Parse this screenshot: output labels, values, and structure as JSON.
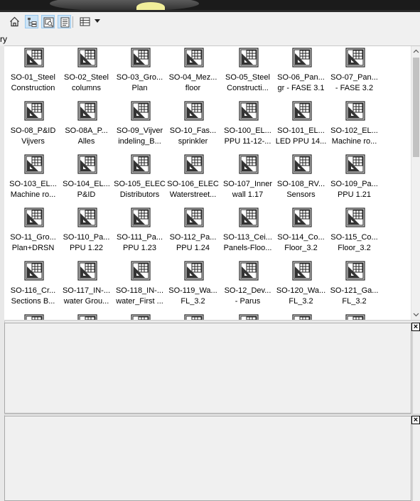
{
  "toolbar": {
    "buttons": [
      {
        "name": "home-button",
        "icon": "home-icon",
        "active": false
      },
      {
        "name": "tree-view-button",
        "icon": "tree-view-icon",
        "active": true
      },
      {
        "name": "preview-button",
        "icon": "preview-icon",
        "active": true
      },
      {
        "name": "details-button",
        "icon": "details-icon",
        "active": true
      },
      {
        "name": "view-mode-button",
        "icon": "grid-view-icon",
        "active": false
      }
    ],
    "dropdown_icon": "chevron-down-icon"
  },
  "breadcrumb": {
    "text": "ry"
  },
  "browser": {
    "item_icon": "sheet-icon",
    "items": [
      {
        "l1": "SO-01_Steel",
        "l2": "Construction"
      },
      {
        "l1": "SO-02_Steel",
        "l2": "columns"
      },
      {
        "l1": "SO-03_Gro...",
        "l2": "Plan"
      },
      {
        "l1": "SO-04_Mez...",
        "l2": "floor"
      },
      {
        "l1": "SO-05_Steel",
        "l2": "Constructi..."
      },
      {
        "l1": "SO-06_Pan...",
        "l2": "gr - FASE 3.1"
      },
      {
        "l1": "SO-07_Pan...",
        "l2": "- FASE 3.2"
      },
      {
        "l1": "SO-08_P&ID",
        "l2": "Vijvers"
      },
      {
        "l1": "SO-08A_P...",
        "l2": "Alles"
      },
      {
        "l1": "SO-09_Vijver",
        "l2": "indeling_B..."
      },
      {
        "l1": "SO-10_Fas...",
        "l2": "sprinkler"
      },
      {
        "l1": "SO-100_EL...",
        "l2": "PPU 11-12-..."
      },
      {
        "l1": "SO-101_EL...",
        "l2": "LED PPU 14..."
      },
      {
        "l1": "SO-102_EL...",
        "l2": "Machine ro..."
      },
      {
        "l1": "SO-103_EL...",
        "l2": "Machine ro..."
      },
      {
        "l1": "SO-104_EL...",
        "l2": "P&ID"
      },
      {
        "l1": "SO-105_ELEC",
        "l2": "Distributors"
      },
      {
        "l1": "SO-106_ELEC",
        "l2": "Waterstreet..."
      },
      {
        "l1": "SO-107_Inner",
        "l2": "wall 1.17"
      },
      {
        "l1": "SO-108_RV...",
        "l2": "Sensors"
      },
      {
        "l1": "SO-109_Pa...",
        "l2": "PPU 1.21"
      },
      {
        "l1": "SO-11_Gro...",
        "l2": "Plan+DRSN"
      },
      {
        "l1": "SO-110_Pa...",
        "l2": "PPU 1.22"
      },
      {
        "l1": "SO-111_Pa...",
        "l2": "PPU 1.23"
      },
      {
        "l1": "SO-112_Pa...",
        "l2": "PPU 1.24"
      },
      {
        "l1": "SO-113_Cei...",
        "l2": "Panels-Floo..."
      },
      {
        "l1": "SO-114_Co...",
        "l2": "Floor_3.2"
      },
      {
        "l1": "SO-115_Co...",
        "l2": "Floor_3.2"
      },
      {
        "l1": "SO-116_Cr...",
        "l2": "Sections B..."
      },
      {
        "l1": "SO-117_IN-...",
        "l2": "water Grou..."
      },
      {
        "l1": "SO-118_IN-...",
        "l2": "water_First ..."
      },
      {
        "l1": "SO-119_Wa...",
        "l2": "FL_3.2"
      },
      {
        "l1": "SO-12_Dev...",
        "l2": "- Parus"
      },
      {
        "l1": "SO-120_Wa...",
        "l2": "FL_3.2"
      },
      {
        "l1": "SO-121_Ga...",
        "l2": "FL_3.2"
      },
      {
        "l1": "",
        "l2": ""
      },
      {
        "l1": "",
        "l2": ""
      },
      {
        "l1": "",
        "l2": ""
      },
      {
        "l1": "",
        "l2": ""
      },
      {
        "l1": "",
        "l2": ""
      },
      {
        "l1": "",
        "l2": ""
      },
      {
        "l1": "",
        "l2": ""
      }
    ]
  },
  "panels": {
    "preview_close": "×",
    "details_close": "×"
  },
  "colors": {
    "active_button": "#cce4f7",
    "title_bar": "#1b1b1b"
  }
}
